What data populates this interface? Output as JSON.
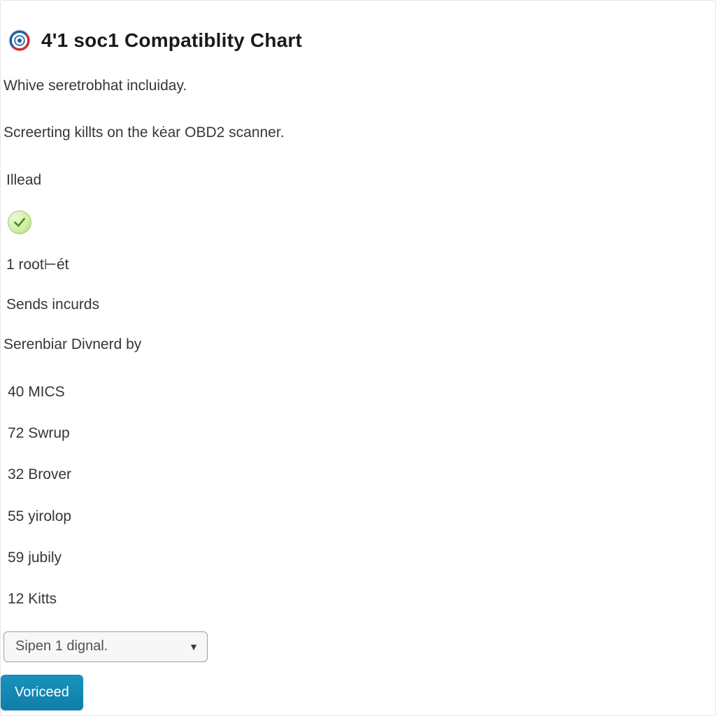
{
  "header": {
    "title": "4'1 soc1 Compatiblity Chart"
  },
  "intro": {
    "line1": "Whive seretrobhat incluiday.",
    "line2": "Screerting killts on the kėar OBD2 scanner."
  },
  "status": {
    "label": "Illead",
    "icon_name": "check-icon"
  },
  "items": {
    "root": "1 root⊢ét",
    "sends": "Sends incurds",
    "serenbiar": "Serenbiar Divnerd by"
  },
  "list": [
    "40 MICS",
    "72 Swrup",
    "32 Brover",
    "55 yirolop",
    "59 jubily",
    "12 Kitts"
  ],
  "select": {
    "selected": "Sipen 1 dignal."
  },
  "actions": {
    "proceed": "Voriceed"
  },
  "colors": {
    "accent": "#1588b3",
    "check_green": "#6fb536"
  }
}
